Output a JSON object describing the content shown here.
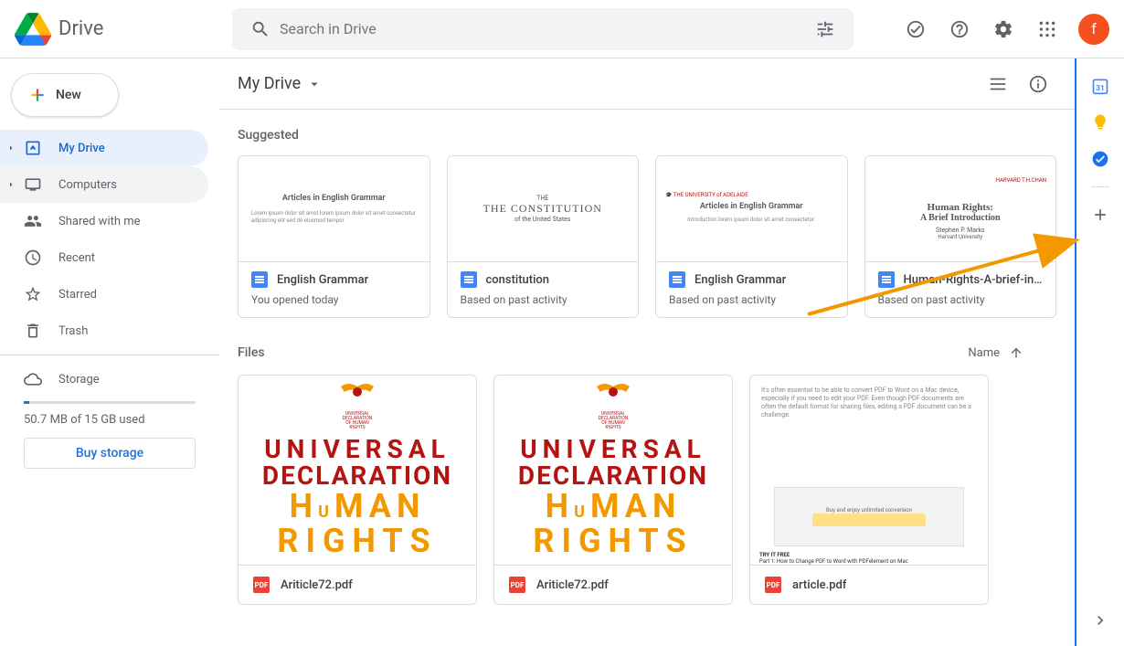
{
  "brand": "Drive",
  "search": {
    "placeholder": "Search in Drive"
  },
  "avatar_letter": "f",
  "new_button": "New",
  "nav": {
    "mydrive": "My Drive",
    "computers": "Computers",
    "shared": "Shared with me",
    "recent": "Recent",
    "starred": "Starred",
    "trash": "Trash",
    "storage": "Storage"
  },
  "storage_used": "50.7 MB of 15 GB used",
  "buy_storage": "Buy storage",
  "breadcrumb": "My Drive",
  "sections": {
    "suggested": "Suggested",
    "files": "Files"
  },
  "sort": {
    "label": "Name"
  },
  "suggested": [
    {
      "title": "English Grammar",
      "subtitle": "You opened today",
      "preview_title": "Articles in English Grammar"
    },
    {
      "title": "constitution",
      "subtitle": "Based on past activity",
      "preview_title": "THE CONSTITUTION",
      "preview_sub": "of the United States"
    },
    {
      "title": "English Grammar",
      "subtitle": "Based on past activity",
      "preview_title": "Articles in English Grammar"
    },
    {
      "title": "Human-Rights-A-brief-in…",
      "subtitle": "Based on past activity",
      "preview_title": "Human Rights:",
      "preview_sub": "A Brief Introduction",
      "preview_author": "Stephen P. Marks",
      "preview_org": "Harvard University"
    }
  ],
  "files": [
    {
      "name": "Ariticle72.pdf",
      "kind": "pdf",
      "poster": "udhr"
    },
    {
      "name": "Ariticle72.pdf",
      "kind": "pdf",
      "poster": "udhr"
    },
    {
      "name": "article.pdf",
      "kind": "pdf",
      "poster": "article"
    }
  ],
  "pdf_badge": "PDF"
}
